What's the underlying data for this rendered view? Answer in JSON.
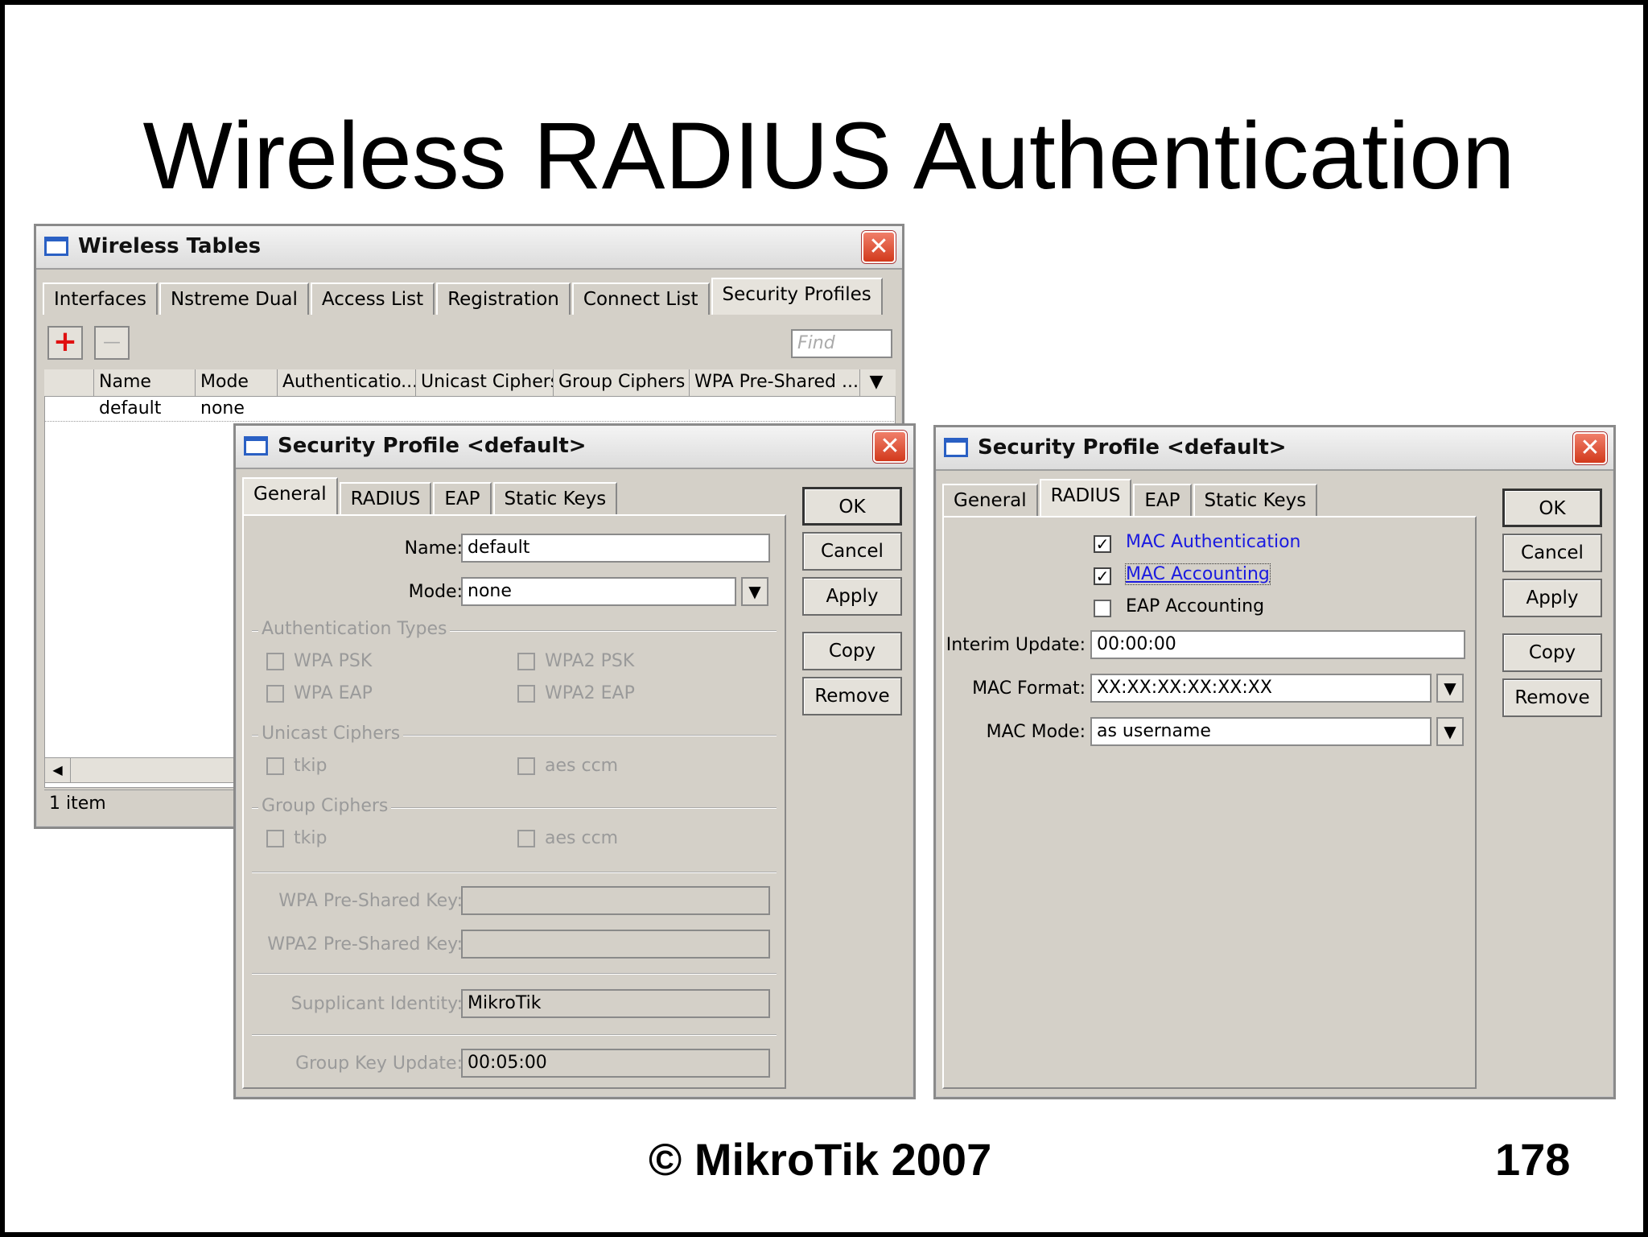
{
  "slide": {
    "title": "Wireless RADIUS Authentication",
    "copyright": "© MikroTik 2007",
    "page_number": "178"
  },
  "wireless_tables": {
    "title": "Wireless Tables",
    "tabs": [
      "Interfaces",
      "Nstreme Dual",
      "Access List",
      "Registration",
      "Connect List",
      "Security Profiles"
    ],
    "active_tab": "Security Profiles",
    "find_placeholder": "Find",
    "add_icon": "+",
    "remove_icon": "—",
    "columns": [
      "Name",
      "Mode",
      "Authenticatio...",
      "Unicast Ciphers",
      "Group Ciphers",
      "WPA Pre-Shared ..."
    ],
    "rows": [
      {
        "name": "default",
        "mode": "none"
      }
    ],
    "status": "1 item"
  },
  "profile_general": {
    "title": "Security Profile <default>",
    "tabs": [
      "General",
      "RADIUS",
      "EAP",
      "Static Keys"
    ],
    "active_tab": "General",
    "buttons": {
      "ok": "OK",
      "cancel": "Cancel",
      "apply": "Apply",
      "copy": "Copy",
      "remove": "Remove"
    },
    "name_label": "Name:",
    "name_value": "default",
    "mode_label": "Mode:",
    "mode_value": "none",
    "auth_types_label": "Authentication Types",
    "wpa_psk": "WPA PSK",
    "wpa2_psk": "WPA2 PSK",
    "wpa_eap": "WPA EAP",
    "wpa2_eap": "WPA2 EAP",
    "unicast_label": "Unicast Ciphers",
    "tkip": "tkip",
    "aes_ccm": "aes ccm",
    "group_label": "Group Ciphers",
    "wpa_key_label": "WPA Pre-Shared Key:",
    "wpa2_key_label": "WPA2 Pre-Shared Key:",
    "supplicant_label": "Supplicant Identity:",
    "supplicant_value": "MikroTik",
    "group_key_label": "Group Key Update:",
    "group_key_value": "00:05:00"
  },
  "profile_radius": {
    "title": "Security Profile <default>",
    "tabs": [
      "General",
      "RADIUS",
      "EAP",
      "Static Keys"
    ],
    "active_tab": "RADIUS",
    "buttons": {
      "ok": "OK",
      "cancel": "Cancel",
      "apply": "Apply",
      "copy": "Copy",
      "remove": "Remove"
    },
    "mac_auth": "MAC Authentication",
    "mac_acct": "MAC Accounting",
    "eap_acct": "EAP Accounting",
    "interim_label": "Interim Update:",
    "interim_value": "00:00:00",
    "mac_format_label": "MAC Format:",
    "mac_format_value": "XX:XX:XX:XX:XX:XX",
    "mac_mode_label": "MAC Mode:",
    "mac_mode_value": "as username"
  }
}
